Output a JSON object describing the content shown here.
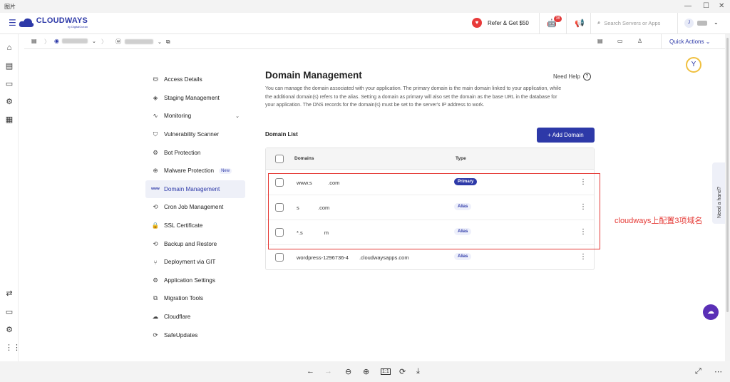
{
  "viewer": {
    "title": "图片",
    "tools": [
      "←",
      "→",
      "⊖",
      "⊕",
      "1:1",
      "⟳",
      "⤓"
    ],
    "expand": "⤢"
  },
  "topbar": {
    "brand": "CLOUDWAYS",
    "brand_sub": "by DigitalOcean",
    "refer_label": "Refer & Get $50",
    "notification_count": "38",
    "search_placeholder": "Search Servers or Apps",
    "avatar_initial": "J"
  },
  "subbar": {
    "quick_actions_label": "Quick Actions"
  },
  "nav": {
    "items": [
      {
        "label": "Access Details",
        "icon": "⛁"
      },
      {
        "label": "Staging Management",
        "icon": "◈"
      },
      {
        "label": "Monitoring",
        "icon": "∿"
      },
      {
        "label": "Vulnerability Scanner",
        "icon": "⛉"
      },
      {
        "label": "Bot Protection",
        "icon": "⚙"
      },
      {
        "label": "Malware Protection",
        "icon": "⊕",
        "badge": "New"
      },
      {
        "label": "Domain Management",
        "icon": "www"
      },
      {
        "label": "Cron Job Management",
        "icon": "⟲"
      },
      {
        "label": "SSL Certificate",
        "icon": "🔒"
      },
      {
        "label": "Backup and Restore",
        "icon": "⟲"
      },
      {
        "label": "Deployment via GIT",
        "icon": "⑂"
      },
      {
        "label": "Application Settings",
        "icon": "⚙"
      },
      {
        "label": "Migration Tools",
        "icon": "⧉"
      },
      {
        "label": "Cloudflare",
        "icon": "☁"
      },
      {
        "label": "SafeUpdates",
        "icon": "⟳"
      }
    ]
  },
  "main": {
    "title": "Domain Management",
    "need_help": "Need Help",
    "description": "You can manage the domain associated with your application. The primary domain is the main domain linked to your application, while the additional domain(s) refers to the alias. Setting a domain as primary will also set the domain as the base URL in the database for your application. The DNS records for the domain(s) must be set to the server's IP address to work.",
    "list_label": "Domain List",
    "add_domain": "+ Add Domain",
    "table": {
      "col_domains": "Domains",
      "col_type": "Type",
      "rows": [
        {
          "domain": "www.s      .com",
          "type": "Primary"
        },
        {
          "domain": "s       .com",
          "type": "Alias"
        },
        {
          "domain": "*.s        m",
          "type": "Alias"
        },
        {
          "domain": "wordpress-1296736-4    .cloudwaysapps.com",
          "type": "Alias"
        }
      ]
    }
  },
  "annotation": "cloudways上配置3项域名",
  "need_hand": "Need a hand?",
  "colors": {
    "brand": "#2d39a8",
    "annotation": "#e53935"
  }
}
